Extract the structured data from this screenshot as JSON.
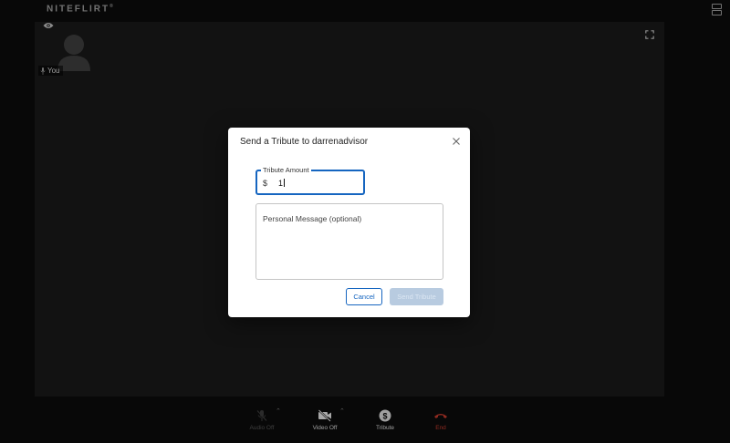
{
  "topbar": {
    "logo_text": "NITEFLIRT",
    "logo_mark": "®",
    "layout_toggle_icon": "layout-rows-icon"
  },
  "stage": {
    "self_label": "You",
    "icons": [
      "eye-icon",
      "avatar-silhouette",
      "mic-small-icon",
      "fullscreen-icon"
    ]
  },
  "dialog": {
    "title": "Send a Tribute to darrenadvisor",
    "close_icon": "close-icon",
    "amount_label": "Tribute Amount",
    "currency_symbol": "$",
    "amount_value": "1",
    "message_placeholder": "Personal Message (optional)",
    "cancel_label": "Cancel",
    "send_label": "Send Tribute",
    "accent_color": "#1565c0"
  },
  "controls": {
    "audio_label": "Audio Off",
    "video_label": "Video Off",
    "tribute_label": "Tribute",
    "end_label": "End",
    "end_color": "#c0392b"
  }
}
